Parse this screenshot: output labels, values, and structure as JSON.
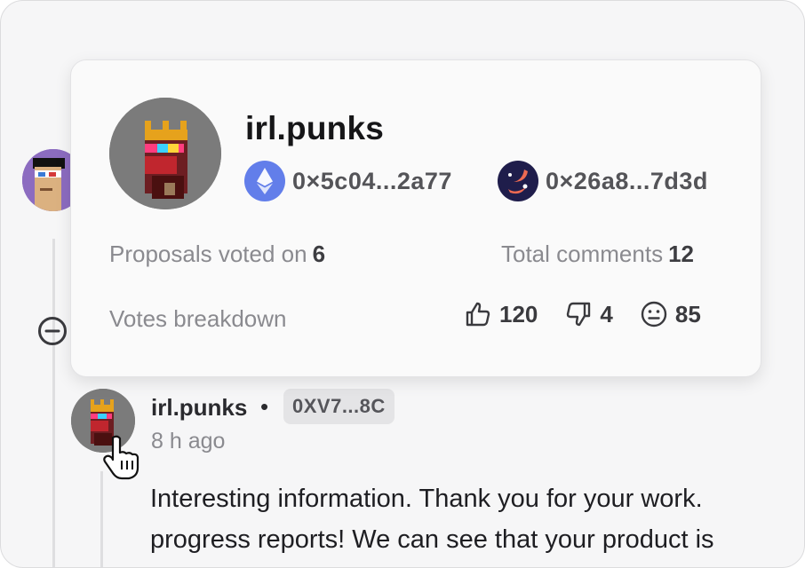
{
  "profile_card": {
    "name": "irl.punks",
    "eth_address": "0×5c04...2a77",
    "starknet_address": "0×26a8...7d3d",
    "proposals_label": "Proposals voted on",
    "proposals_value": "6",
    "comments_label": "Total comments",
    "comments_value": "12",
    "votes_label": "Votes breakdown",
    "votes_up": "120",
    "votes_down": "4",
    "votes_neutral": "85"
  },
  "comment": {
    "author": "irl.punks",
    "separator": "•",
    "address_badge": "0XV7...8C",
    "time": "8 h ago",
    "text_line1": "Interesting information. Thank you for your work.",
    "text_line2": "progress reports! We can see that your product is"
  },
  "icons": {
    "eth": "ethereum-icon",
    "starknet": "starknet-icon",
    "thumbs_up": "thumbs-up-icon",
    "thumbs_down": "thumbs-down-icon",
    "neutral": "neutral-face-icon",
    "collapse": "collapse-minus-icon",
    "cursor": "hand-pointer-icon"
  },
  "colors": {
    "eth_blue": "#627eea",
    "starknet_navy": "#1f1d4b",
    "starknet_orange": "#ee6a52"
  }
}
